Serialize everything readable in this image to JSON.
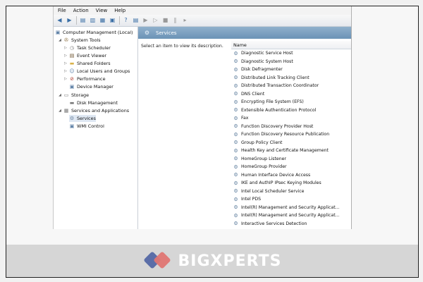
{
  "menu": [
    "File",
    "Action",
    "View",
    "Help"
  ],
  "tree": {
    "root": "Computer Management (Local)",
    "system_tools": "System Tools",
    "task_scheduler": "Task Scheduler",
    "event_viewer": "Event Viewer",
    "shared_folders": "Shared Folders",
    "local_users": "Local Users and Groups",
    "performance": "Performance",
    "device_manager": "Device Manager",
    "storage": "Storage",
    "disk_management": "Disk Management",
    "services_apps": "Services and Applications",
    "services": "Services",
    "wmi_control": "WMI Control"
  },
  "panel": {
    "title": "Services",
    "description": "Select an item to view its description.",
    "column_name": "Name",
    "services": [
      "Diagnostic Service Host",
      "Diagnostic System Host",
      "Disk Defragmenter",
      "Distributed Link Tracking Client",
      "Distributed Transaction Coordinator",
      "DNS Client",
      "Encrypting File System (EFS)",
      "Extensible Authentication Protocol",
      "Fax",
      "Function Discovery Provider Host",
      "Function Discovery Resource Publication",
      "Group Policy Client",
      "Health Key and Certificate Management",
      "HomeGroup Listener",
      "HomeGroup Provider",
      "Human Interface Device Access",
      "IKE and AuthIP IPsec Keying Modules",
      "Intel Local Scheduler Service",
      "Intel PDS",
      "Intel(R) Management and Security Applicat...",
      "Intel(R) Management and Security Applicat...",
      "Interactive Services Detection"
    ]
  },
  "brand": {
    "name": "BIGXPERTS"
  }
}
